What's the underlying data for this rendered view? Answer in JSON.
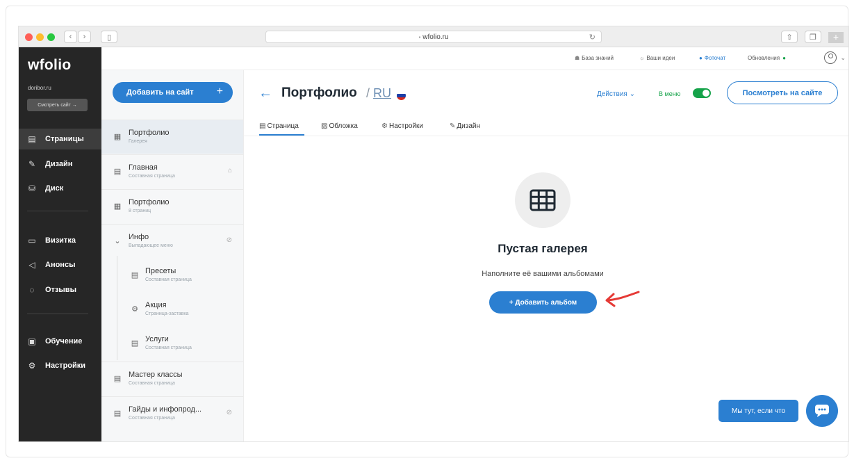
{
  "browser": {
    "url": "wfolio.ru"
  },
  "sidebar": {
    "logo": "wfolio",
    "domain": "doribor.ru",
    "view_site_label": "Смотреть сайт →",
    "items": [
      {
        "label": "Страницы",
        "icon": "page-icon"
      },
      {
        "label": "Дизайн",
        "icon": "pen-icon"
      },
      {
        "label": "Диск",
        "icon": "database-icon"
      },
      {
        "label": "Визитка",
        "icon": "card-icon"
      },
      {
        "label": "Анонсы",
        "icon": "megaphone-icon"
      },
      {
        "label": "Отзывы",
        "icon": "chat-icon"
      },
      {
        "label": "Обучение",
        "icon": "book-icon"
      },
      {
        "label": "Настройки",
        "icon": "gear-icon"
      }
    ]
  },
  "pages": {
    "add_label": "Добавить на сайт",
    "items": [
      {
        "title": "Портфолио",
        "sub": "Галерея"
      },
      {
        "title": "Главная",
        "sub": "Составная страница"
      },
      {
        "title": "Портфолио",
        "sub": "8 страниц"
      },
      {
        "title": "Инфо",
        "sub": "Выпадающее меню"
      },
      {
        "title": "Пресеты",
        "sub": "Составная страница"
      },
      {
        "title": "Акция",
        "sub": "Страница-заставка"
      },
      {
        "title": "Услуги",
        "sub": "Составная страница"
      },
      {
        "title": "Мастер классы",
        "sub": "Составная страница"
      },
      {
        "title": "Гайды и инфопрод...",
        "sub": "Составная страница"
      }
    ]
  },
  "topbar": {
    "knowledge": "База знаний",
    "ideas": "Ваши идеи",
    "photochat": "Фоточат",
    "updates": "Обновления"
  },
  "header": {
    "title": "Портфолио",
    "lang": "RU",
    "actions": "Действия",
    "in_menu": "В меню",
    "view_on_site": "Посмотреть на сайте"
  },
  "tabs": [
    "Страница",
    "Обложка",
    "Настройки",
    "Дизайн"
  ],
  "empty": {
    "title": "Пустая галерея",
    "subtitle": "Наполните её вашими альбомами",
    "button": "+ Добавить альбом"
  },
  "help": {
    "label": "Мы тут, если что"
  },
  "colors": {
    "accent": "#2b7fd1",
    "toggle": "#16a34a",
    "sidebar": "#262626"
  }
}
